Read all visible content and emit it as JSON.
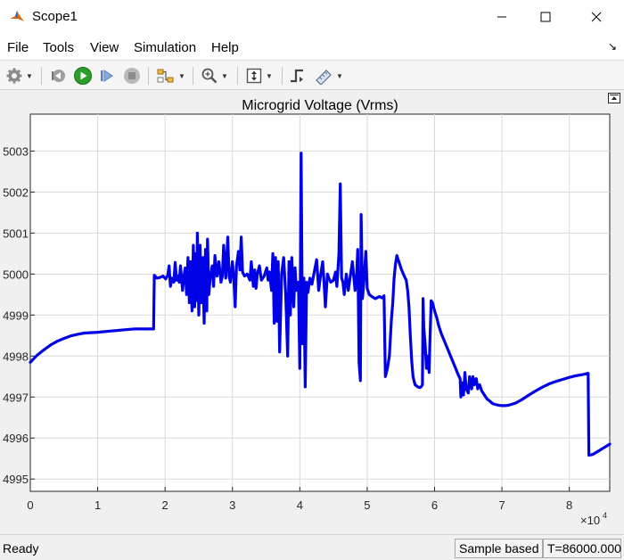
{
  "window": {
    "title": "Scope1"
  },
  "menu": {
    "items": [
      "File",
      "Tools",
      "View",
      "Simulation",
      "Help"
    ]
  },
  "toolbar": {
    "icons": [
      "gear-icon",
      "step-back-icon",
      "run-icon",
      "step-forward-icon",
      "stop-icon",
      "signal-select-icon",
      "zoom-icon",
      "fit-axes-icon",
      "trigger-icon",
      "measurements-icon"
    ]
  },
  "status": {
    "ready": "Ready",
    "mode": "Sample based",
    "time": "T=86000.000"
  },
  "colors": {
    "series": "#0000e6",
    "grid": "#d9d9d9",
    "axes_bg": "#ffffff",
    "run_green": "#2aa02a"
  },
  "chart_data": {
    "type": "line",
    "title": "Microgrid Voltage (Vrms)",
    "xlabel": "",
    "ylabel": "",
    "x_multiplier": "×10^4",
    "x_ticks": [
      0,
      1,
      2,
      3,
      4,
      5,
      6,
      7,
      8
    ],
    "y_ticks": [
      4995,
      4996,
      4997,
      4998,
      4999,
      5000,
      5001,
      5002,
      5003
    ],
    "xlim": [
      0,
      8.6
    ],
    "ylim": [
      4994.7,
      5003.9
    ],
    "grid": true,
    "legend": "none",
    "series": [
      {
        "values": [
          [
            0,
            4997.85
          ],
          [
            0.1,
            4998.02
          ],
          [
            0.2,
            4998.15
          ],
          [
            0.3,
            4998.27
          ],
          [
            0.4,
            4998.36
          ],
          [
            0.5,
            4998.43
          ],
          [
            0.6,
            4998.49
          ],
          [
            0.7,
            4998.53
          ],
          [
            0.8,
            4998.56
          ],
          [
            1.0,
            4998.58
          ],
          [
            1.2,
            4998.61
          ],
          [
            1.4,
            4998.64
          ],
          [
            1.55,
            4998.66
          ],
          [
            1.7,
            4998.66
          ],
          [
            1.83,
            4998.66
          ],
          [
            1.84,
            4999.97
          ],
          [
            1.88,
            4999.9
          ],
          [
            1.93,
            4999.92
          ],
          [
            1.97,
            4999.95
          ],
          [
            2.01,
            4999.88
          ],
          [
            2.04,
            4999.97
          ],
          [
            2.06,
            5000.2
          ],
          [
            2.08,
            4999.7
          ],
          [
            2.1,
            4999.9
          ],
          [
            2.13,
            4999.8
          ],
          [
            2.15,
            5000.28
          ],
          [
            2.17,
            4999.85
          ],
          [
            2.19,
            4999.95
          ],
          [
            2.21,
            4999.8
          ],
          [
            2.23,
            5000.2
          ],
          [
            2.26,
            4999.6
          ],
          [
            2.28,
            4999.95
          ],
          [
            2.3,
            5000.15
          ],
          [
            2.32,
            4999.5
          ],
          [
            2.34,
            5000.4
          ],
          [
            2.36,
            4999.3
          ],
          [
            2.38,
            5000.3
          ],
          [
            2.4,
            4999.1
          ],
          [
            2.42,
            5000.7
          ],
          [
            2.44,
            4999.2
          ],
          [
            2.46,
            5000.5
          ],
          [
            2.47,
            4999.35
          ],
          [
            2.48,
            5001.0
          ],
          [
            2.5,
            4999.0
          ],
          [
            2.52,
            5000.7
          ],
          [
            2.54,
            4999.3
          ],
          [
            2.56,
            5000.4
          ],
          [
            2.58,
            4998.8
          ],
          [
            2.6,
            5000.6
          ],
          [
            2.62,
            4999.1
          ],
          [
            2.63,
            5000.85
          ],
          [
            2.65,
            4999.5
          ],
          [
            2.67,
            4999.9
          ],
          [
            2.7,
            5000.2
          ],
          [
            2.72,
            4999.7
          ],
          [
            2.74,
            5000.45
          ],
          [
            2.77,
            4999.95
          ],
          [
            2.8,
            5000.3
          ],
          [
            2.83,
            4999.8
          ],
          [
            2.85,
            4999.95
          ],
          [
            2.87,
            5000.7
          ],
          [
            2.9,
            4999.9
          ],
          [
            2.93,
            5000.9
          ],
          [
            2.95,
            4999.95
          ],
          [
            2.97,
            4999.8
          ],
          [
            3.0,
            5000.3
          ],
          [
            3.02,
            4999.9
          ],
          [
            3.04,
            4999.2
          ],
          [
            3.06,
            5000.2
          ],
          [
            3.09,
            5000.55
          ],
          [
            3.11,
            5000.1
          ],
          [
            3.13,
            5000.9
          ],
          [
            3.15,
            5000.05
          ],
          [
            3.18,
            4999.95
          ],
          [
            3.22,
            5000.0
          ],
          [
            3.26,
            4999.85
          ],
          [
            3.28,
            5000.3
          ],
          [
            3.31,
            4999.7
          ],
          [
            3.33,
            5000.1
          ],
          [
            3.35,
            4999.65
          ],
          [
            3.37,
            5000.0
          ],
          [
            3.4,
            5000.2
          ],
          [
            3.43,
            4999.85
          ],
          [
            3.47,
            4999.95
          ],
          [
            3.51,
            5000.15
          ],
          [
            3.53,
            4999.85
          ],
          [
            3.55,
            5000.05
          ],
          [
            3.58,
            4999.6
          ],
          [
            3.6,
            5000.5
          ],
          [
            3.62,
            4998.8
          ],
          [
            3.64,
            5000.4
          ],
          [
            3.66,
            4998.85
          ],
          [
            3.68,
            5000.3
          ],
          [
            3.7,
            4998.1
          ],
          [
            3.73,
            5000.0
          ],
          [
            3.76,
            5000.4
          ],
          [
            3.79,
            4999.5
          ],
          [
            3.82,
            4998.0
          ],
          [
            3.84,
            5000.3
          ],
          [
            3.86,
            4999.0
          ],
          [
            3.88,
            5000.4
          ],
          [
            3.91,
            4999.2
          ],
          [
            3.93,
            5000.15
          ],
          [
            3.95,
            4999.6
          ],
          [
            3.98,
            4999.8
          ],
          [
            4.0,
            4997.7
          ],
          [
            4.02,
            5002.95
          ],
          [
            4.04,
            4998.3
          ],
          [
            4.06,
            4999.9
          ],
          [
            4.08,
            4997.25
          ],
          [
            4.1,
            4999.8
          ],
          [
            4.12,
            4999.55
          ],
          [
            4.15,
            4999.9
          ],
          [
            4.18,
            4999.75
          ],
          [
            4.22,
            5000.1
          ],
          [
            4.25,
            5000.35
          ],
          [
            4.28,
            4999.6
          ],
          [
            4.31,
            5000.0
          ],
          [
            4.34,
            5000.3
          ],
          [
            4.36,
            4999.8
          ],
          [
            4.38,
            4999.2
          ],
          [
            4.41,
            5000.0
          ],
          [
            4.43,
            4999.9
          ],
          [
            4.46,
            4999.8
          ],
          [
            4.5,
            4999.85
          ],
          [
            4.53,
            5000.05
          ],
          [
            4.55,
            4999.7
          ],
          [
            4.58,
            5000.5
          ],
          [
            4.6,
            5002.2
          ],
          [
            4.62,
            4999.9
          ],
          [
            4.64,
            4999.8
          ],
          [
            4.66,
            4999.5
          ],
          [
            4.69,
            5000.0
          ],
          [
            4.72,
            4999.6
          ],
          [
            4.75,
            4999.95
          ],
          [
            4.78,
            5000.3
          ],
          [
            4.8,
            4999.95
          ],
          [
            4.82,
            4999.6
          ],
          [
            4.84,
            4999.85
          ],
          [
            4.86,
            5000.6
          ],
          [
            4.88,
            4997.85
          ],
          [
            4.9,
            4997.4
          ],
          [
            4.91,
            5001.45
          ],
          [
            4.93,
            4999.4
          ],
          [
            4.95,
            4999.8
          ],
          [
            4.98,
            5000.55
          ],
          [
            5.0,
            4999.65
          ],
          [
            5.03,
            4999.5
          ],
          [
            5.07,
            4999.45
          ],
          [
            5.12,
            4999.4
          ],
          [
            5.18,
            4999.45
          ],
          [
            5.22,
            4999.42
          ],
          [
            5.25,
            4999.47
          ],
          [
            5.27,
            4997.5
          ],
          [
            5.3,
            4997.7
          ],
          [
            5.33,
            4998.0
          ],
          [
            5.36,
            4998.9
          ],
          [
            5.38,
            4999.3
          ],
          [
            5.4,
            4999.9
          ],
          [
            5.42,
            5000.25
          ],
          [
            5.44,
            5000.45
          ],
          [
            5.46,
            5000.35
          ],
          [
            5.48,
            5000.25
          ],
          [
            5.51,
            5000.1
          ],
          [
            5.55,
            4999.95
          ],
          [
            5.58,
            4999.85
          ],
          [
            5.6,
            4999.6
          ],
          [
            5.62,
            4999.2
          ],
          [
            5.64,
            4998.5
          ],
          [
            5.66,
            4997.9
          ],
          [
            5.68,
            4997.5
          ],
          [
            5.71,
            4997.3
          ],
          [
            5.75,
            4997.25
          ],
          [
            5.78,
            4997.23
          ],
          [
            5.8,
            4997.25
          ],
          [
            5.82,
            4997.3
          ],
          [
            5.83,
            4999.4
          ],
          [
            5.84,
            4998.7
          ],
          [
            5.86,
            4998.3
          ],
          [
            5.88,
            4997.7
          ],
          [
            5.9,
            4998.0
          ],
          [
            5.92,
            4997.6
          ],
          [
            5.93,
            4998.3
          ],
          [
            5.95,
            4999.35
          ],
          [
            5.97,
            4999.3
          ],
          [
            6.0,
            4999.1
          ],
          [
            6.03,
            4998.95
          ],
          [
            6.06,
            4998.75
          ],
          [
            6.1,
            4998.55
          ],
          [
            6.15,
            4998.35
          ],
          [
            6.2,
            4998.15
          ],
          [
            6.25,
            4997.95
          ],
          [
            6.3,
            4997.75
          ],
          [
            6.35,
            4997.55
          ],
          [
            6.38,
            4997.45
          ],
          [
            6.39,
            4997.0
          ],
          [
            6.41,
            4997.35
          ],
          [
            6.43,
            4997.05
          ],
          [
            6.45,
            4997.6
          ],
          [
            6.47,
            4997.2
          ],
          [
            6.5,
            4997.1
          ],
          [
            6.52,
            4997.5
          ],
          [
            6.55,
            4997.2
          ],
          [
            6.57,
            4997.5
          ],
          [
            6.59,
            4997.3
          ],
          [
            6.62,
            4997.45
          ],
          [
            6.64,
            4997.2
          ],
          [
            6.67,
            4997.3
          ],
          [
            6.7,
            4997.15
          ],
          [
            6.74,
            4997.05
          ],
          [
            6.78,
            4996.95
          ],
          [
            6.82,
            4996.9
          ],
          [
            6.86,
            4996.84
          ],
          [
            6.9,
            4996.82
          ],
          [
            6.95,
            4996.8
          ],
          [
            7.0,
            4996.79
          ],
          [
            7.05,
            4996.79
          ],
          [
            7.1,
            4996.8
          ],
          [
            7.2,
            4996.85
          ],
          [
            7.3,
            4996.94
          ],
          [
            7.4,
            4997.05
          ],
          [
            7.5,
            4997.15
          ],
          [
            7.6,
            4997.24
          ],
          [
            7.7,
            4997.32
          ],
          [
            7.8,
            4997.38
          ],
          [
            7.9,
            4997.43
          ],
          [
            8.0,
            4997.48
          ],
          [
            8.1,
            4997.52
          ],
          [
            8.2,
            4997.55
          ],
          [
            8.28,
            4997.58
          ],
          [
            8.29,
            4995.58
          ],
          [
            8.35,
            4995.6
          ],
          [
            8.4,
            4995.65
          ],
          [
            8.45,
            4995.7
          ],
          [
            8.5,
            4995.75
          ],
          [
            8.55,
            4995.8
          ],
          [
            8.6,
            4995.85
          ]
        ]
      }
    ]
  }
}
